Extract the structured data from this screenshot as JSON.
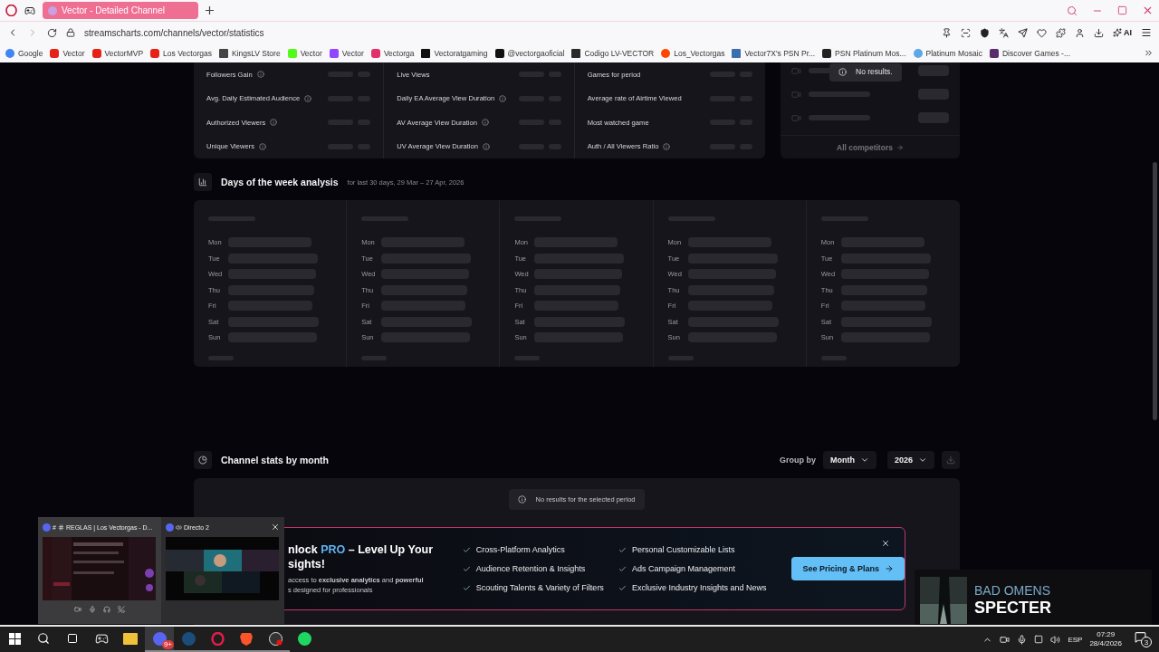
{
  "browser": {
    "tab_title": "Vector - Detailed Channel",
    "url": "streamscharts.com/channels/vector/statistics",
    "ai_label": "AI",
    "bookmarks": [
      {
        "label": "Google",
        "kind": "google"
      },
      {
        "label": "Vector",
        "kind": "youtube"
      },
      {
        "label": "VectorMVP",
        "kind": "youtube"
      },
      {
        "label": "Los Vectorgas",
        "kind": "youtube"
      },
      {
        "label": "KingsLV Store",
        "kind": "crown"
      },
      {
        "label": "Vector",
        "kind": "kick"
      },
      {
        "label": "Vector",
        "kind": "twitch"
      },
      {
        "label": "Vectorga",
        "kind": "instagram"
      },
      {
        "label": "Vectoratgaming",
        "kind": "x"
      },
      {
        "label": "@vectorgaoficial",
        "kind": "tiktok"
      },
      {
        "label": "Codigo LV-VECTOR",
        "kind": "epic"
      },
      {
        "label": "Los_Vectorgas",
        "kind": "reddit"
      },
      {
        "label": "Vector7X's PSN Pr...",
        "kind": "trophy"
      },
      {
        "label": "PSN Platinum Mos...",
        "kind": "ph"
      },
      {
        "label": "Platinum Mosaic",
        "kind": "pin"
      },
      {
        "label": "Discover Games -...",
        "kind": "kh"
      }
    ]
  },
  "stats": {
    "columns": [
      {
        "items": [
          {
            "label": "Followers Gain",
            "info": true
          },
          {
            "label": "Avg. Daily Estimated Audience",
            "info": true
          },
          {
            "label": "Authorized Viewers",
            "info": true
          },
          {
            "label": "Unique Viewers",
            "info": true
          }
        ]
      },
      {
        "items": [
          {
            "label": "Live Views",
            "info": false
          },
          {
            "label": "Daily EA Average View Duration",
            "info": true
          },
          {
            "label": "AV Average View Duration",
            "info": true
          },
          {
            "label": "UV Average View Duration",
            "info": true
          }
        ]
      },
      {
        "items": [
          {
            "label": "Games for period",
            "info": false
          },
          {
            "label": "Average rate of Airtime Viewed",
            "info": false
          },
          {
            "label": "Most watched game",
            "info": false
          },
          {
            "label": "Auth / All Viewers Ratio",
            "info": true
          }
        ]
      }
    ]
  },
  "competitors": {
    "tooltip": "No results.",
    "link": "All competitors"
  },
  "days_analysis": {
    "title": "Days of the week analysis",
    "subtitle": "for last 30 days, 29 Mar – 27 Apr, 2026",
    "panels": [
      {
        "days": [
          "Mon",
          "Tue",
          "Wed",
          "Thu",
          "Fri",
          "Sat",
          "Sun"
        ]
      },
      {
        "days": [
          "Mon",
          "Tue",
          "Wed",
          "Thu",
          "Fri",
          "Sat",
          "Sun"
        ]
      },
      {
        "days": [
          "Mon",
          "Tue",
          "Wed",
          "Thu",
          "Fri",
          "Sat",
          "Sun"
        ]
      },
      {
        "days": [
          "Mon",
          "Tue",
          "Wed",
          "Thu",
          "Fri",
          "Sat",
          "Sun"
        ]
      },
      {
        "days": [
          "Mon",
          "Tue",
          "Wed",
          "Thu",
          "Fri",
          "Sat",
          "Sun"
        ]
      }
    ]
  },
  "monthly": {
    "title": "Channel stats by month",
    "group_by_label": "Group by",
    "group_by": "Month",
    "year": "2026",
    "empty": "No results for the selected period"
  },
  "promo": {
    "title_lead": "nlock",
    "title_accent": "PRO",
    "title_rest": "– Level Up Your",
    "title_line2": "sights!",
    "description_line1": "access to **exclusive analytics** and **powerful**",
    "description_line2": "s designed for professionals",
    "features": [
      "Cross-Platform Analytics",
      "Audience Retention & Insights",
      "Scouting Talents & Variety of Filters",
      "Personal Customizable Lists",
      "Ads Campaign Management",
      "Exclusive Industry Insights and News"
    ],
    "button": "See Pricing & Plans"
  },
  "task_previews": [
    {
      "prefix": "#",
      "title": "REGLAS | Los Vectorgas - D...",
      "kind": "text_channel"
    },
    {
      "title": "Directo 2",
      "kind": "voice_channel"
    }
  ],
  "now_playing": {
    "artist": "BAD OMENS",
    "title": "SPECTER"
  },
  "taskbar": {
    "apps": [
      {
        "kind": "game",
        "running": false,
        "selected": false
      },
      {
        "kind": "folder",
        "running": false,
        "selected": false
      },
      {
        "kind": "discord",
        "running": true,
        "selected": true,
        "badge": "9+"
      },
      {
        "kind": "steam",
        "running": true,
        "selected": false
      },
      {
        "kind": "opera",
        "running": true,
        "selected": false
      },
      {
        "kind": "brave",
        "running": true,
        "selected": false
      },
      {
        "kind": "obs",
        "running": true,
        "selected": false
      },
      {
        "kind": "spotify",
        "running": false,
        "selected": false
      }
    ],
    "language": "ESP",
    "time": "07:29",
    "date": "28/4/2026",
    "notifications": "3"
  }
}
